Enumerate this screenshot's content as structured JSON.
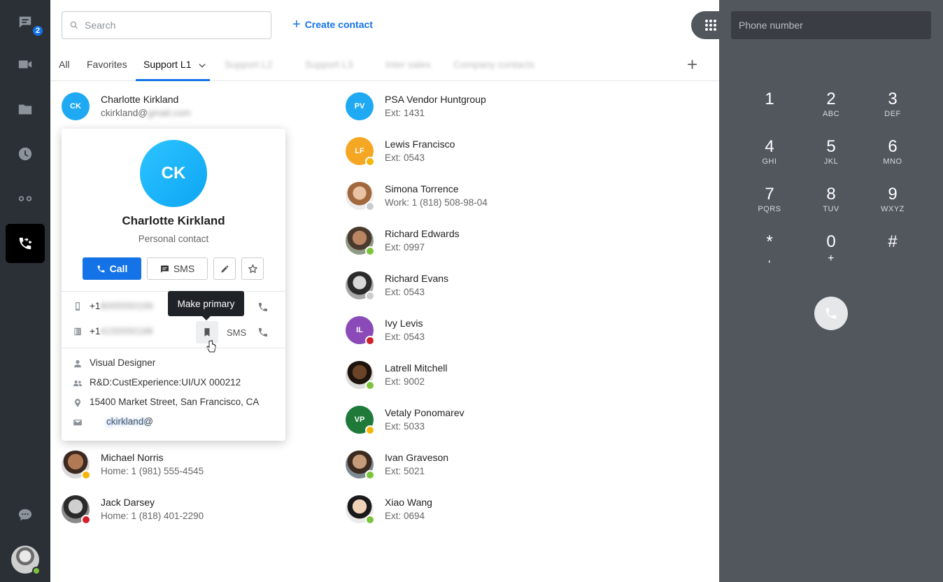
{
  "rail": {
    "chat_badge": "2",
    "items": [
      "chat-icon",
      "video-icon",
      "folder-icon",
      "history-icon",
      "voicemail-icon",
      "calls-contacts-icon",
      "messages-icon"
    ]
  },
  "search": {
    "placeholder": "Search"
  },
  "create_contact": "Create contact",
  "tabs": [
    {
      "label": "All"
    },
    {
      "label": "Favorites"
    },
    {
      "label": "Support L1",
      "selected": true
    },
    {
      "label": "Support L2",
      "obscured": true
    },
    {
      "label": "Support L3",
      "obscured": true
    },
    {
      "label": "Inter sales",
      "obscured": true
    },
    {
      "label": "Company contacts",
      "obscured": true
    }
  ],
  "left_contacts": [
    {
      "name": "Charlotte Kirkland",
      "sub": "ckirkland@",
      "sub_hidden": "gmail.com",
      "initials": "CK",
      "color": "#1ea9f2"
    },
    {
      "name": "Michael Norris",
      "sub": "Home: 1 (981) 555-4545",
      "status": "away",
      "status_color": "#f5b50a"
    },
    {
      "name": "Jack Darsey",
      "sub": "Home: 1 (818) 401-2290",
      "status": "dnd",
      "status_color": "#d1202b"
    }
  ],
  "right_contacts": [
    {
      "name": "PSA Vendor Huntgroup",
      "sub": "Ext: 1431",
      "initials": "PV",
      "color": "#1ea9f2"
    },
    {
      "name": "Lewis Francisco",
      "sub": "Ext: 0543",
      "initials": "LF",
      "color": "#f5a623",
      "status_color": "#f5b50a"
    },
    {
      "name": "Simona Torrence",
      "sub": "Work: 1 (818) 508-98-04",
      "status_color": "#c9ccd0"
    },
    {
      "name": "Richard Edwards",
      "sub": "Ext: 0997",
      "status_color": "#7cc23b"
    },
    {
      "name": "Richard Evans",
      "sub": "Ext: 0543",
      "status_color": "#c9ccd0"
    },
    {
      "name": "Ivy Levis",
      "sub": "Ext: 0543",
      "initials": "IL",
      "color": "#8a4bb8",
      "status_color": "#d1202b"
    },
    {
      "name": "Latrell Mitchell",
      "sub": "Ext: 9002",
      "status_color": "#7cc23b"
    },
    {
      "name": "Vetaly Ponomarev",
      "sub": "Ext: 5033",
      "initials": "VP",
      "color": "#1f7a3a",
      "status_color": "#f5b50a"
    },
    {
      "name": "Ivan Graveson",
      "sub": "Ext: 5021",
      "status_color": "#7cc23b"
    },
    {
      "name": "Xiao Wang",
      "sub": "Ext: 0694",
      "status_color": "#7cc23b"
    }
  ],
  "card": {
    "initials": "CK",
    "name": "Charlotte Kirkland",
    "type": "Personal contact",
    "call": "Call",
    "sms": "SMS",
    "phones": [
      {
        "prefix": "+1",
        "hidden": "8005550199",
        "icon": "mobile-icon"
      },
      {
        "prefix": "+1",
        "hidden": "4155550188",
        "icon": "desk-phone-icon"
      }
    ],
    "tooltip": "Make primary",
    "sms_link": "SMS",
    "title": "Visual Designer",
    "department": "R&D:CustExperience:UI/UX 000212",
    "address": "15400 Market Street, San Francisco, CA",
    "email": "ckirkland@",
    "email_hidden": "gmail.com"
  },
  "dialer": {
    "placeholder": "Phone number",
    "keys": [
      {
        "d": "1",
        "l": ""
      },
      {
        "d": "2",
        "l": "ABC"
      },
      {
        "d": "3",
        "l": "DEF"
      },
      {
        "d": "4",
        "l": "GHI"
      },
      {
        "d": "5",
        "l": "JKL"
      },
      {
        "d": "6",
        "l": "MNO"
      },
      {
        "d": "7",
        "l": "PQRS"
      },
      {
        "d": "8",
        "l": "TUV"
      },
      {
        "d": "9",
        "l": "WXYZ"
      },
      {
        "d": "*",
        "l": ","
      },
      {
        "d": "0",
        "l": "+"
      },
      {
        "d": "#",
        "l": ""
      }
    ]
  },
  "colors": {
    "accent": "#1473e6",
    "rail": "#2b3036",
    "dialer": "#52575e"
  }
}
